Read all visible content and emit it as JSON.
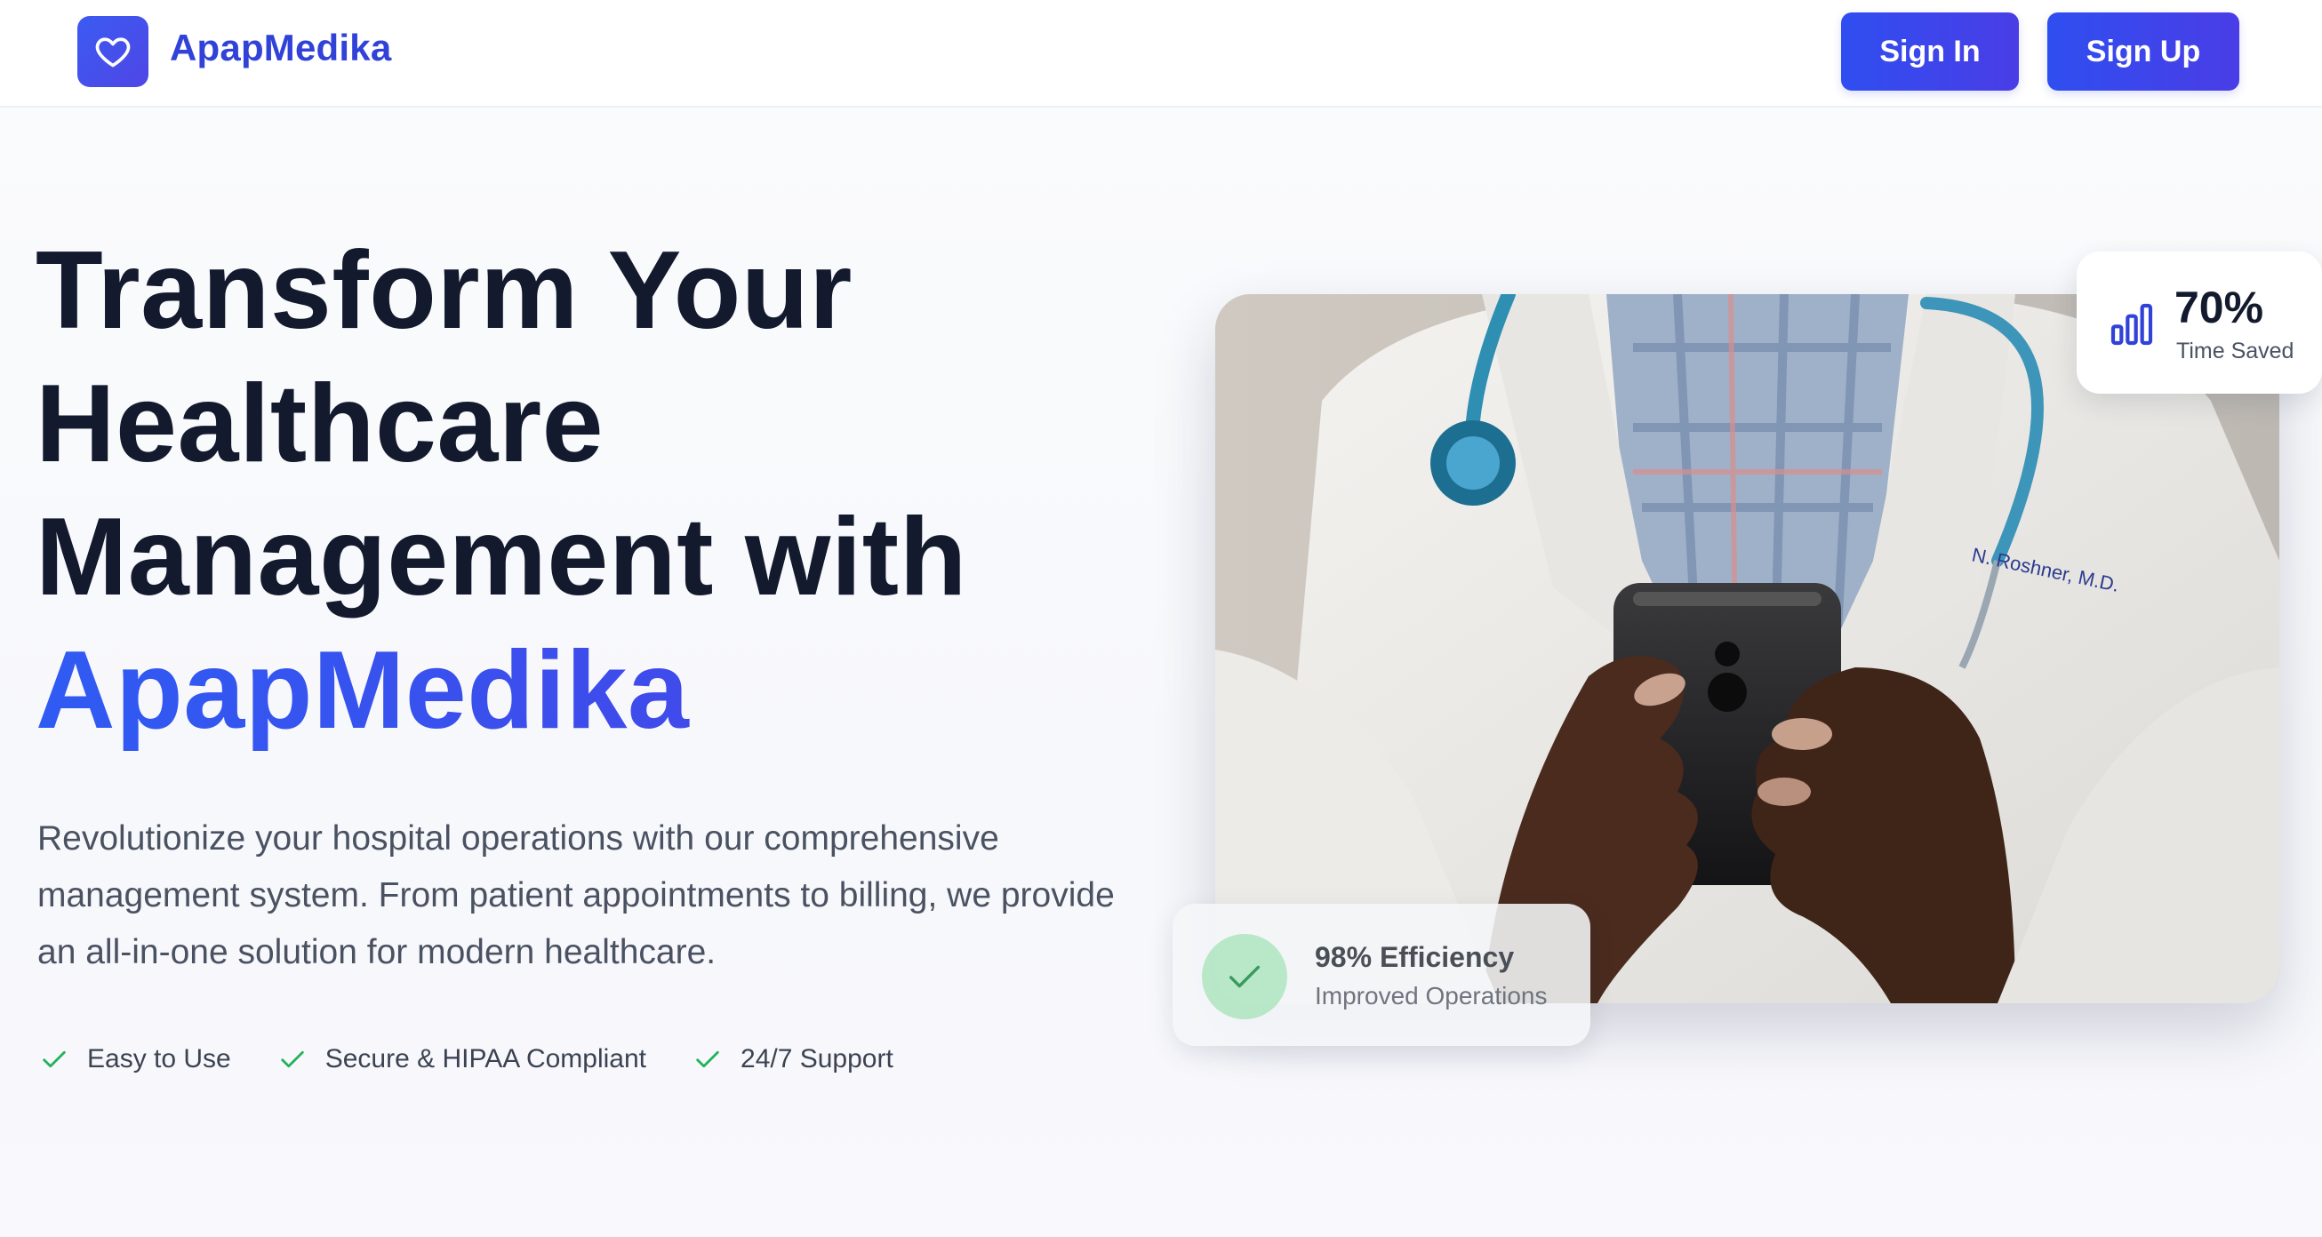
{
  "header": {
    "brand": "ApapMedika",
    "logo_icon": "heart-icon",
    "sign_in_label": "Sign In",
    "sign_up_label": "Sign Up"
  },
  "hero": {
    "headline_lines": [
      "Transform Your",
      "Healthcare",
      "Management with"
    ],
    "headline_brand": "ApapMedika",
    "description": "Revolutionize your hospital operations with our comprehensive management system. From patient appointments to billing, we provide an all-in-one solution for modern healthcare.",
    "features": [
      {
        "label": "Easy to Use",
        "icon": "check-icon"
      },
      {
        "label": "Secure & HIPAA Compliant",
        "icon": "check-icon"
      },
      {
        "label": "24/7 Support",
        "icon": "check-icon"
      }
    ]
  },
  "stats": {
    "time_saved": {
      "value": "70%",
      "label": "Time Saved",
      "icon": "bar-chart-icon"
    },
    "efficiency": {
      "title": "98% Efficiency",
      "subtitle": "Improved Operations",
      "icon": "check-icon"
    }
  },
  "colors": {
    "brand_blue": "#3142d8",
    "button_gradient_start": "#2f4ef0",
    "button_gradient_end": "#4a3de6",
    "heading_dark": "#141a2e",
    "check_green": "#22b35a"
  }
}
